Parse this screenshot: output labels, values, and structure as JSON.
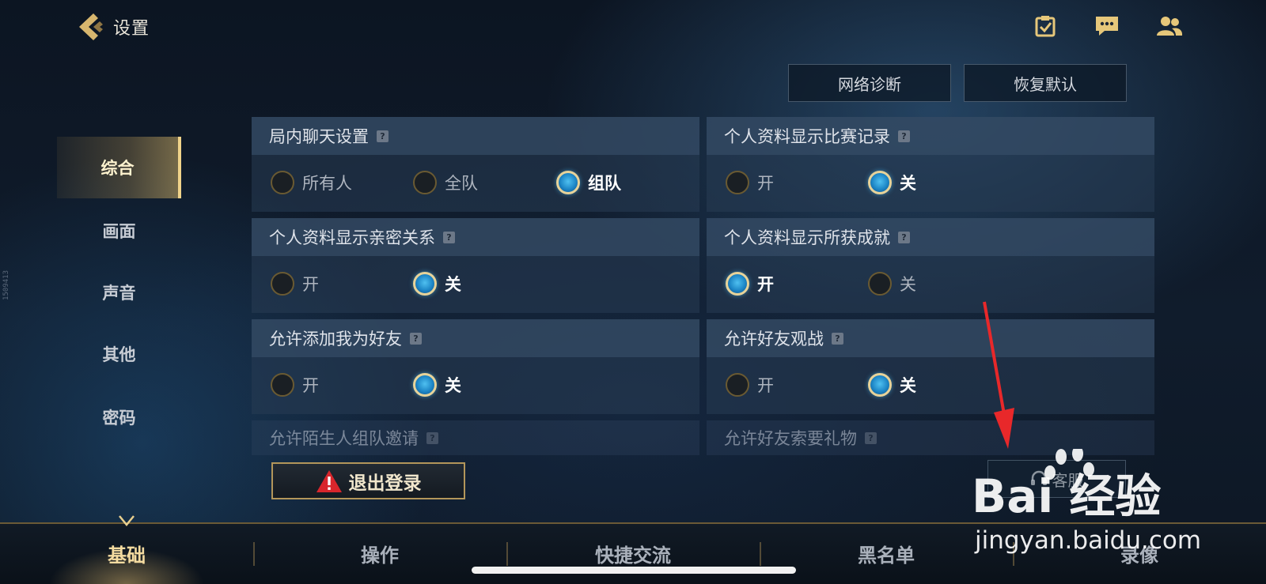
{
  "header": {
    "title": "设置",
    "icons": [
      "task-icon",
      "chat-icon",
      "friends-icon"
    ],
    "buttons": {
      "network_diagnosis": "网络诊断",
      "restore_default": "恢复默认"
    }
  },
  "sidebar": {
    "items": [
      {
        "label": "综合",
        "active": true
      },
      {
        "label": "画面",
        "active": false
      },
      {
        "label": "声音",
        "active": false
      },
      {
        "label": "其他",
        "active": false
      },
      {
        "label": "密码",
        "active": false
      }
    ]
  },
  "settings": {
    "chat": {
      "title": "局内聊天设置",
      "help": "?",
      "options": [
        "所有人",
        "全队",
        "组队"
      ],
      "selected": "组队"
    },
    "match_record": {
      "title": "个人资料显示比赛记录",
      "help": "?",
      "options": [
        "开",
        "关"
      ],
      "selected": "关"
    },
    "intimacy": {
      "title": "个人资料显示亲密关系",
      "help": "?",
      "options": [
        "开",
        "关"
      ],
      "selected": "关"
    },
    "achievements": {
      "title": "个人资料显示所获成就",
      "help": "?",
      "options": [
        "开",
        "关"
      ],
      "selected": "开"
    },
    "add_friend": {
      "title": "允许添加我为好友",
      "help": "?",
      "options": [
        "开",
        "关"
      ],
      "selected": "关"
    },
    "spectate": {
      "title": "允许好友观战",
      "help": "?",
      "options": [
        "开",
        "关"
      ],
      "selected": "关"
    },
    "stranger_invite": {
      "title": "允许陌生人组队邀请",
      "help": "?"
    },
    "gift_request": {
      "title": "允许好友索要礼物",
      "help": "?"
    }
  },
  "actions": {
    "logout": "退出登录",
    "customer_service": "客服"
  },
  "bottom_tabs": [
    {
      "label": "基础",
      "active": true
    },
    {
      "label": "操作",
      "active": false
    },
    {
      "label": "快捷交流",
      "active": false
    },
    {
      "label": "黑名单",
      "active": false
    },
    {
      "label": "录像",
      "active": false
    }
  ],
  "side_id": "1509413",
  "watermark": {
    "brand": "Bai  经验",
    "url": "jingyan.baidu.com"
  },
  "colors": {
    "accent_gold": "#f0d38a",
    "radio_blue": "#1d86c6",
    "warning_red": "#d8262c"
  }
}
